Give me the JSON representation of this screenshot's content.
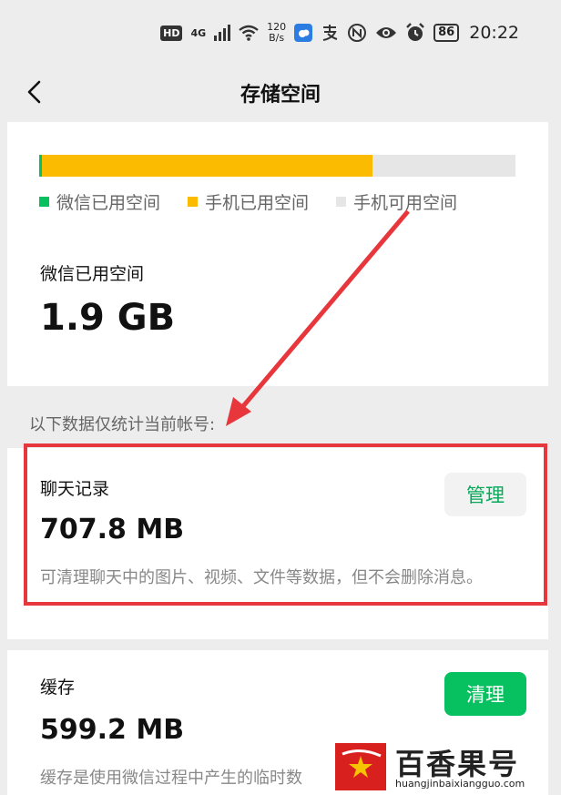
{
  "status_bar": {
    "hd": "HD",
    "network": "4G",
    "speed_value": "120",
    "speed_unit": "B/s",
    "battery": "86",
    "time": "20:22",
    "icons": [
      "hd-icon",
      "signal-icon",
      "wifi-icon",
      "weather-app-icon",
      "alipay-icon",
      "nfc-icon",
      "eye-icon",
      "alarm-icon",
      "battery-icon"
    ]
  },
  "nav": {
    "title": "存储空间",
    "back_icon": "chevron-left-icon"
  },
  "storage_bar": {
    "wechat_used_fraction": 0.006,
    "phone_used_fraction": 0.7,
    "colors": {
      "wechat": "#07c160",
      "phone": "#fabb00",
      "free": "#e6e6e6"
    }
  },
  "legend": {
    "wechat_used": "微信已用空间",
    "phone_used": "手机已用空间",
    "phone_free": "手机可用空间"
  },
  "wechat_usage": {
    "label": "微信已用空间",
    "value": "1.9 GB"
  },
  "note": "以下数据仅统计当前帐号:",
  "chat_records": {
    "title": "聊天记录",
    "value": "707.8 MB",
    "button": "管理",
    "desc": "可清理聊天中的图片、视频、文件等数据，但不会删除消息。"
  },
  "cache": {
    "title": "缓存",
    "value": "599.2 MB",
    "button": "清理",
    "desc": "缓存是使用微信过程中产生的临时数"
  },
  "watermark": {
    "text": "百香果号",
    "url": "huangjinbaixiangguo.com"
  },
  "annotation_color": "#e8373c"
}
